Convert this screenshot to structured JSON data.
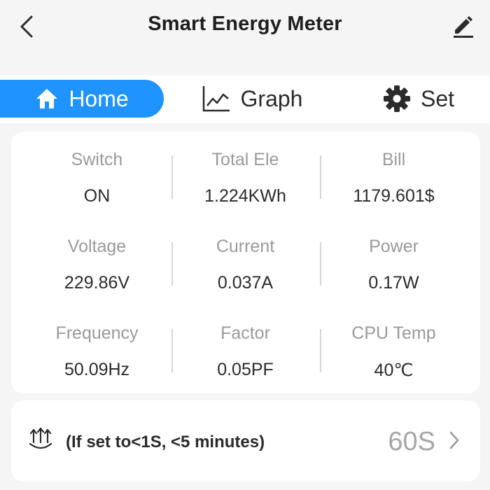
{
  "header": {
    "title": "Smart Energy Meter"
  },
  "tabs": [
    {
      "label": "Home",
      "icon": "home-icon",
      "active": true
    },
    {
      "label": "Graph",
      "icon": "line-chart-icon",
      "active": false
    },
    {
      "label": "Set",
      "icon": "gear-icon",
      "active": false
    }
  ],
  "metrics": [
    [
      {
        "label": "Switch",
        "value": "ON"
      },
      {
        "label": "Total Ele",
        "value": "1.224KWh"
      },
      {
        "label": "Bill",
        "value": "1179.601$"
      }
    ],
    [
      {
        "label": "Voltage",
        "value": "229.86V"
      },
      {
        "label": "Current",
        "value": "0.037A"
      },
      {
        "label": "Power",
        "value": "0.17W"
      }
    ],
    [
      {
        "label": "Frequency",
        "value": "50.09Hz"
      },
      {
        "label": "Factor",
        "value": "0.05PF"
      },
      {
        "label": "CPU Temp",
        "value": "40℃"
      }
    ]
  ],
  "interval": {
    "icon": "upload-refresh-icon",
    "text": "(If set to<1S, <5 minutes)",
    "value": "60S"
  },
  "colors": {
    "accent": "#1f93ff",
    "background": "#f5f5f5",
    "card": "#ffffff",
    "label": "#9a9a9a",
    "text": "#2b2b2b"
  }
}
